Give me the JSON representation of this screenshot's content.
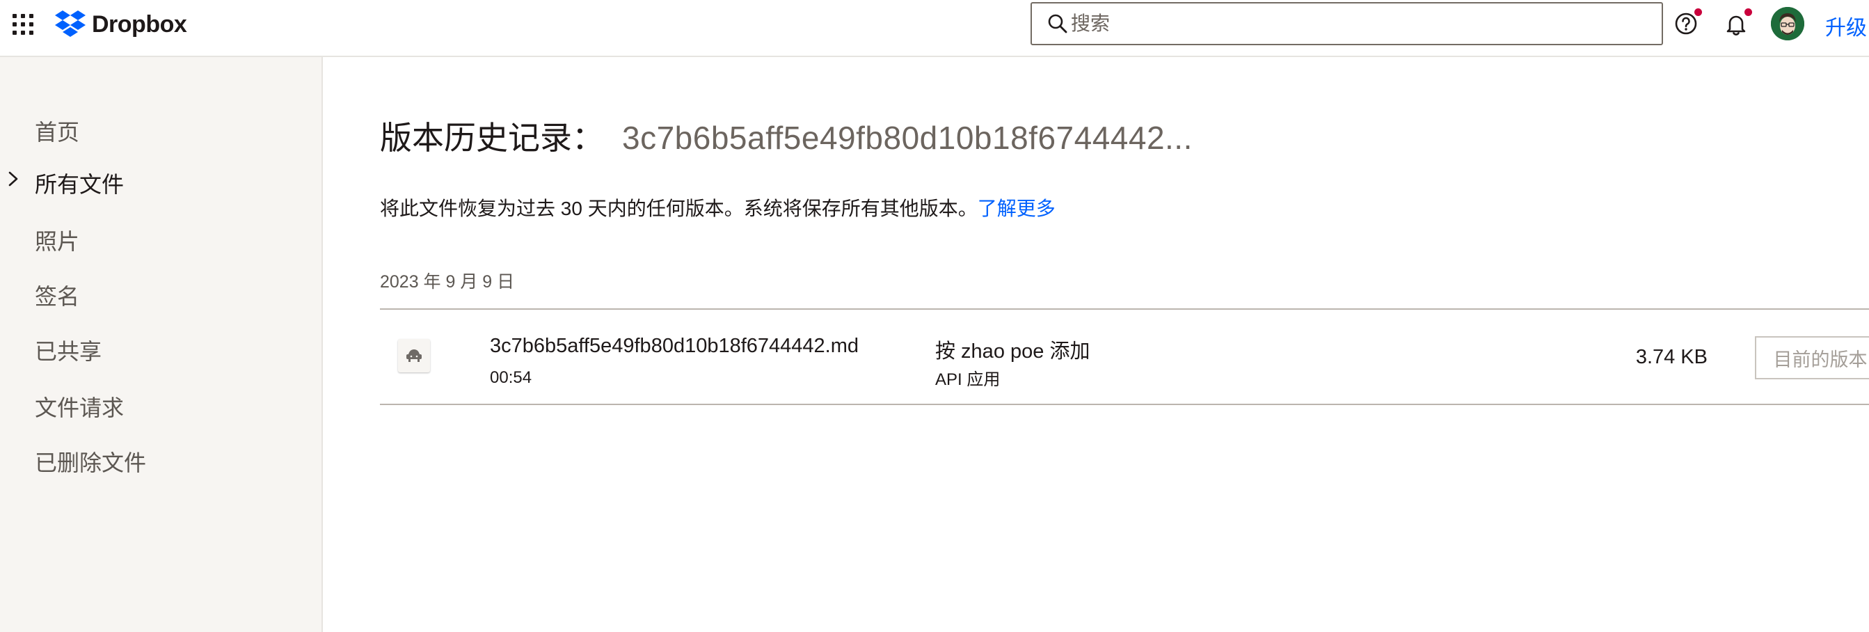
{
  "header": {
    "app_name": "Dropbox",
    "search_placeholder": "搜索",
    "upgrade_label": "升级",
    "brand_color": "#0061fe",
    "notification_color": "#c9003c"
  },
  "sidebar": {
    "items": [
      {
        "label": "首页"
      },
      {
        "label": "所有文件",
        "active": true
      },
      {
        "label": "照片"
      },
      {
        "label": "签名"
      },
      {
        "label": "已共享"
      },
      {
        "label": "文件请求"
      },
      {
        "label": "已删除文件"
      }
    ]
  },
  "main": {
    "title_label": "版本历史记录：",
    "title_file": "3c7b6b5aff5e49fb80d10b18f6744442...",
    "description": "将此文件恢复为过去 30 天内的任何版本。系统将保存所有其他版本。",
    "learn_more": "了解更多",
    "date_header": "2023 年 9 月 9 日",
    "versions": [
      {
        "file_name": "3c7b6b5aff5e49fb80d10b18f6744442.md",
        "time": "00:54",
        "author": "按 zhao poe 添加",
        "source": "API 应用",
        "size": "3.74 KB",
        "action_label": "目前的版本",
        "thumb_icon": "app-icon"
      }
    ]
  }
}
